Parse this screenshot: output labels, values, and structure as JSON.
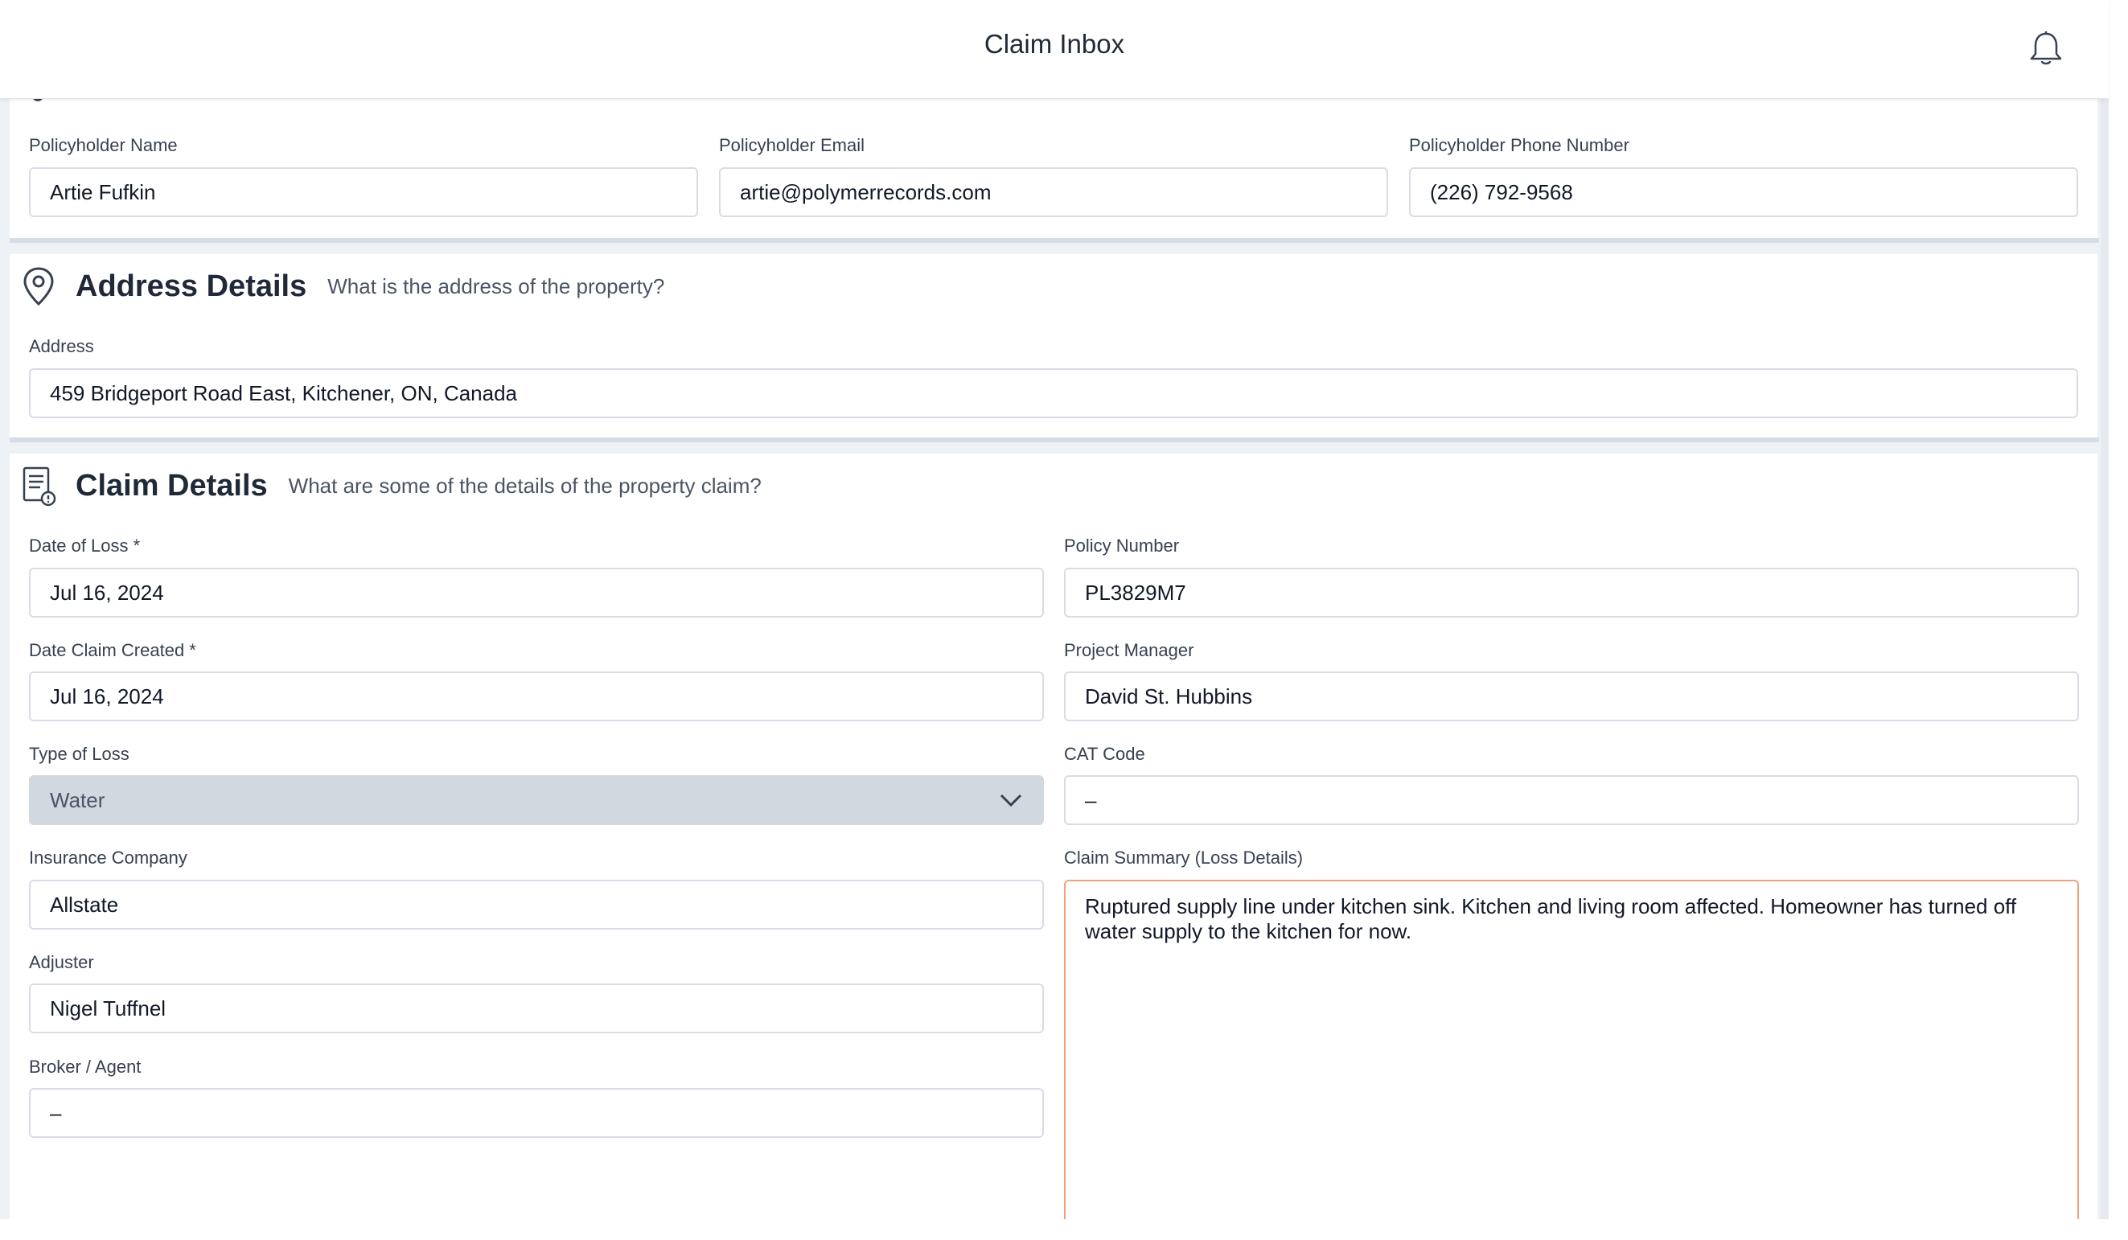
{
  "header": {
    "title": "Claim Inbox",
    "bell_icon": "bell-icon"
  },
  "policyholder": {
    "name_label": "Policyholder Name",
    "name_value": "Artie Fufkin",
    "email_label": "Policyholder Email",
    "email_value": "artie@polymerrecords.com",
    "phone_label": "Policyholder Phone Number",
    "phone_value": "(226) 792-9568"
  },
  "address": {
    "title": "Address Details",
    "subtitle": "What is the address of the property?",
    "icon": "map-pin-icon",
    "address_label": "Address",
    "address_value": "459 Bridgeport Road East, Kitchener, ON, Canada"
  },
  "claim": {
    "title": "Claim Details",
    "subtitle": "What are some of the details of the property claim?",
    "icon": "document-icon",
    "date_of_loss_label": "Date of Loss *",
    "date_of_loss_value": "Jul 16, 2024",
    "date_created_label": "Date Claim Created *",
    "date_created_value": "Jul 16, 2024",
    "type_of_loss_label": "Type of Loss",
    "type_of_loss_value": "Water",
    "insurance_company_label": "Insurance Company",
    "insurance_company_value": "Allstate",
    "adjuster_label": "Adjuster",
    "adjuster_value": "Nigel Tuffnel",
    "broker_label": "Broker / Agent",
    "broker_value": "–",
    "policy_number_label": "Policy Number",
    "policy_number_value": "PL3829M7",
    "project_manager_label": "Project Manager",
    "project_manager_value": "David St. Hubbins",
    "cat_code_label": "CAT Code",
    "cat_code_value": "–",
    "summary_label": "Claim Summary (Loss Details)",
    "summary_value": "Ruptured supply line under kitchen sink. Kitchen and living room affected. Homeowner has turned off water supply to the kitchen for now."
  },
  "colors": {
    "accent_border": "#f2a07b",
    "select_bg": "#d1d8e0",
    "section_rule": "#d5dde8"
  }
}
